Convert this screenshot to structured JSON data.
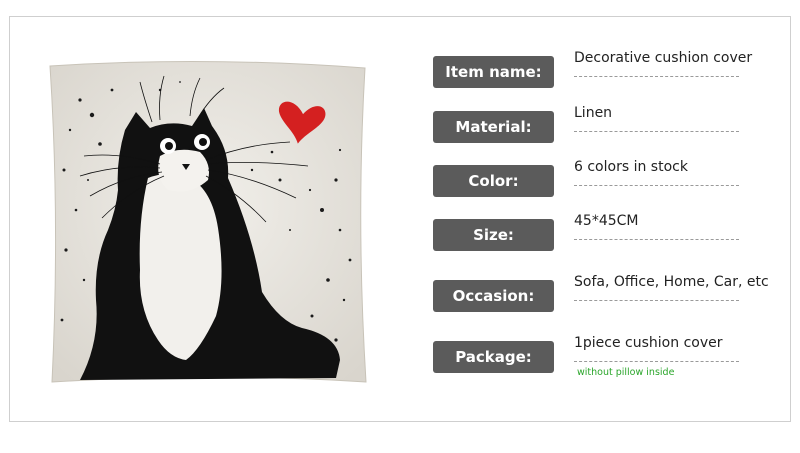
{
  "specs": [
    {
      "label": "Item name:",
      "value": "Decorative cushion cover"
    },
    {
      "label": "Material:",
      "value": "Linen"
    },
    {
      "label": "Color:",
      "value": "6 colors in stock"
    },
    {
      "label": "Size:",
      "value": "45*45CM"
    },
    {
      "label": "Occasion:",
      "value": "Sofa, Office, Home, Car, etc"
    },
    {
      "label": "Package:",
      "value": "1piece cushion cover",
      "note": "without pillow inside"
    }
  ],
  "colors": {
    "label_bg": "#5b5b5b",
    "label_text": "#ffffff",
    "note": "#2aa52a",
    "heart": "#d42020",
    "linen": "#ebe8e2"
  }
}
